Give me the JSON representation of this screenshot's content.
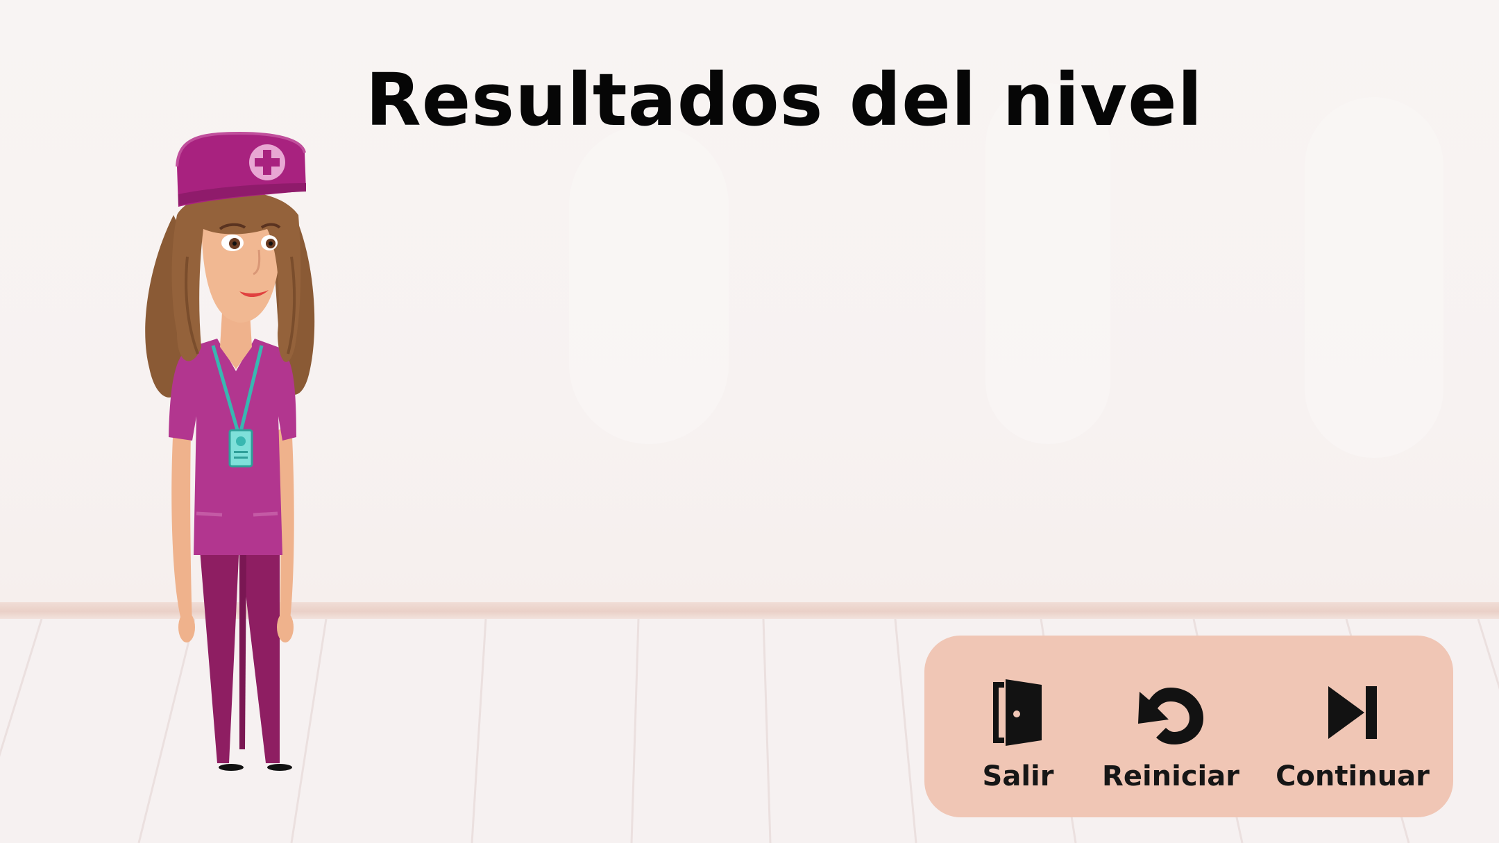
{
  "screen": {
    "title": "Resultados del nivel"
  },
  "character": {
    "icon": "nurse-character"
  },
  "menu": {
    "background_color": "#f0c6b5",
    "buttons": [
      {
        "label": "Salir",
        "icon": "exit-door-icon"
      },
      {
        "label": "Reiniciar",
        "icon": "restart-arrow-icon"
      },
      {
        "label": "Continuar",
        "icon": "skip-next-icon"
      }
    ]
  },
  "colors": {
    "scrubs": "#b2368f",
    "pants": "#8e1e62",
    "hair": "#8a5a35",
    "lanyard": "#39b7b1"
  }
}
